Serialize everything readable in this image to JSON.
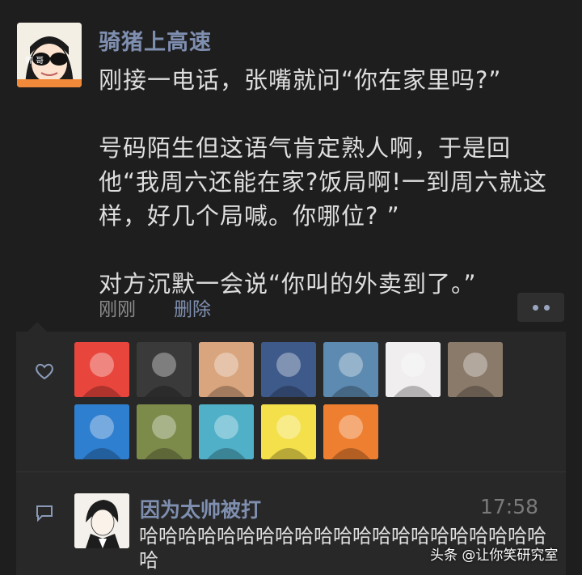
{
  "post": {
    "author": "骑猪上高速",
    "avatar_text": "帅 哥",
    "paragraphs": [
      "刚接一电话，张嘴就问“你在家里吗?”",
      "号码陌生但这语气肯定熟人啊，于是回他“我周六还能在家?饭局啊!一到周六就这样，好几个局喊。你哪位? ”",
      "对方沉默一会说“你叫的外卖到了。”"
    ],
    "time": "刚刚",
    "delete_label": "删除"
  },
  "likes": {
    "icon": "heart-icon",
    "avatars": [
      {
        "name": "fox-cartoon",
        "color": "#e8453c"
      },
      {
        "name": "dark-knight-figure",
        "color": "#3a3a3a"
      },
      {
        "name": "girl-photo",
        "color": "#d9a57e"
      },
      {
        "name": "glasses-boy",
        "color": "#3e5a8a"
      },
      {
        "name": "couple-photo",
        "color": "#5c8ab0"
      },
      {
        "name": "suited-man-sketch",
        "color": "#f0eeee"
      },
      {
        "name": "white-shirt-man",
        "color": "#8a7a6a"
      },
      {
        "name": "chibi-girl",
        "color": "#2f7fd0"
      },
      {
        "name": "red-creature",
        "color": "#7c8a4a"
      },
      {
        "name": "straw-hat-character",
        "color": "#4fb0c8"
      },
      {
        "name": "yellow-cartoon",
        "color": "#f4e04a"
      },
      {
        "name": "panda-cartoon",
        "color": "#ef7f30"
      }
    ]
  },
  "comment": {
    "icon": "comment-icon",
    "author": "因为太帅被打",
    "time": "17:58",
    "text": "哈哈哈哈哈哈哈哈哈哈哈哈哈哈哈哈哈哈哈哈哈哈"
  },
  "watermark": "头条 @让你笑研究室",
  "colors": {
    "background": "#1e1e1e",
    "panel": "#282828",
    "link": "#7f8fb0"
  }
}
